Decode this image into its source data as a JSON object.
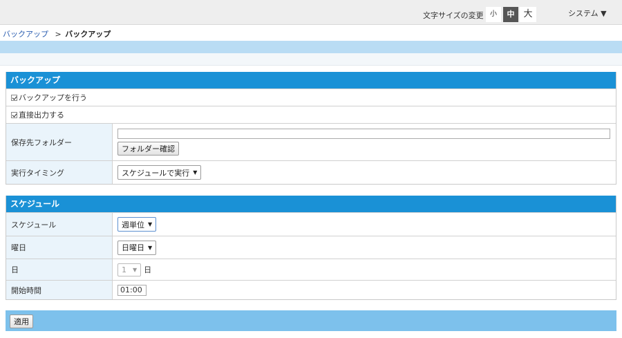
{
  "header": {
    "font_size_label": "文字サイズの変更",
    "font_sizes": [
      "小",
      "中",
      "大"
    ],
    "system_menu": "システム ▼"
  },
  "breadcrumb": {
    "link": "バックアップ",
    "separator": ">",
    "current": "バックアップ"
  },
  "backup": {
    "title": "バックアップ",
    "do_backup_label": "バックアップを行う",
    "direct_output_label": "直接出力する",
    "folder_label": "保存先フォルダー",
    "folder_value": "",
    "folder_button": "フォルダー確認",
    "timing_label": "実行タイミング",
    "timing_value": "スケジュールで実行"
  },
  "schedule": {
    "title": "スケジュール",
    "schedule_label": "スケジュール",
    "schedule_value": "週単位",
    "weekday_label": "曜日",
    "weekday_value": "日曜日",
    "day_label": "日",
    "day_value": "1",
    "day_suffix": "日",
    "start_label": "開始時間",
    "start_value": "01:00"
  },
  "footer": {
    "apply_button": "適用"
  },
  "colors": {
    "section_header": "#1a91d6",
    "label_cell": "#eaf4fb",
    "footer": "#7dc1ec",
    "band": "#b9dcf4"
  }
}
